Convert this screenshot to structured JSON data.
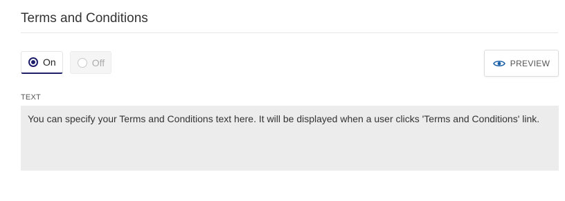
{
  "section": {
    "title": "Terms and Conditions"
  },
  "toggle": {
    "options": [
      {
        "label": "On",
        "selected": true
      },
      {
        "label": "Off",
        "selected": false
      }
    ]
  },
  "preview": {
    "label": "PREVIEW",
    "icon": "eye-icon",
    "color": "#1a5fa8"
  },
  "text_field": {
    "label": "TEXT",
    "value": "You can specify your Terms and Conditions text here. It will be displayed when a user clicks 'Terms and Conditions' link."
  },
  "colors": {
    "accent": "#1d1d6b",
    "field_background": "#ececec"
  }
}
